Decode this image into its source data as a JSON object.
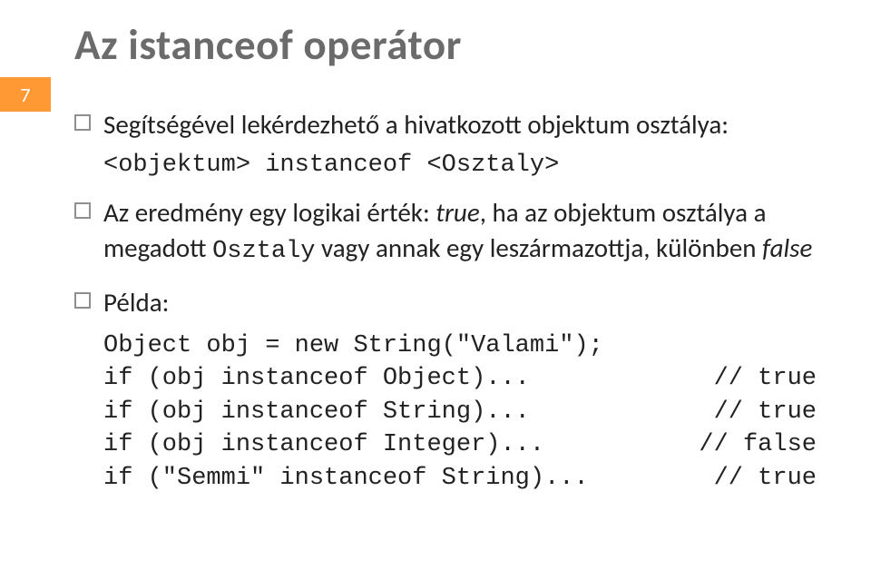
{
  "page_number": "7",
  "title": "Az istanceof operátor",
  "bullets": {
    "b1": "Segítségével lekérdezhető a hivatkozott objektum osztálya:",
    "b1_code": "<objektum> instanceof <Osztaly>",
    "b2_pre": "Az eredmény egy logikai érték: ",
    "b2_true": "true",
    "b2_mid": ", ha az objektum osztálya a megadott ",
    "b2_code": "Osztaly",
    "b2_mid2": " vagy annak egy leszármazottja, különben ",
    "b2_false": "false",
    "b3": "Példa:"
  },
  "code": {
    "l1": "Object obj = new String(\"Valami\");",
    "l2a": "if (obj instanceof Object)...",
    "l2b": "// true",
    "l3a": "if (obj instanceof String)...",
    "l3b": "// true",
    "l4a": "if (obj instanceof Integer)...",
    "l4b": "// false",
    "l5a": "if (\"Semmi\" instanceof String)...",
    "l5b": "// true"
  }
}
